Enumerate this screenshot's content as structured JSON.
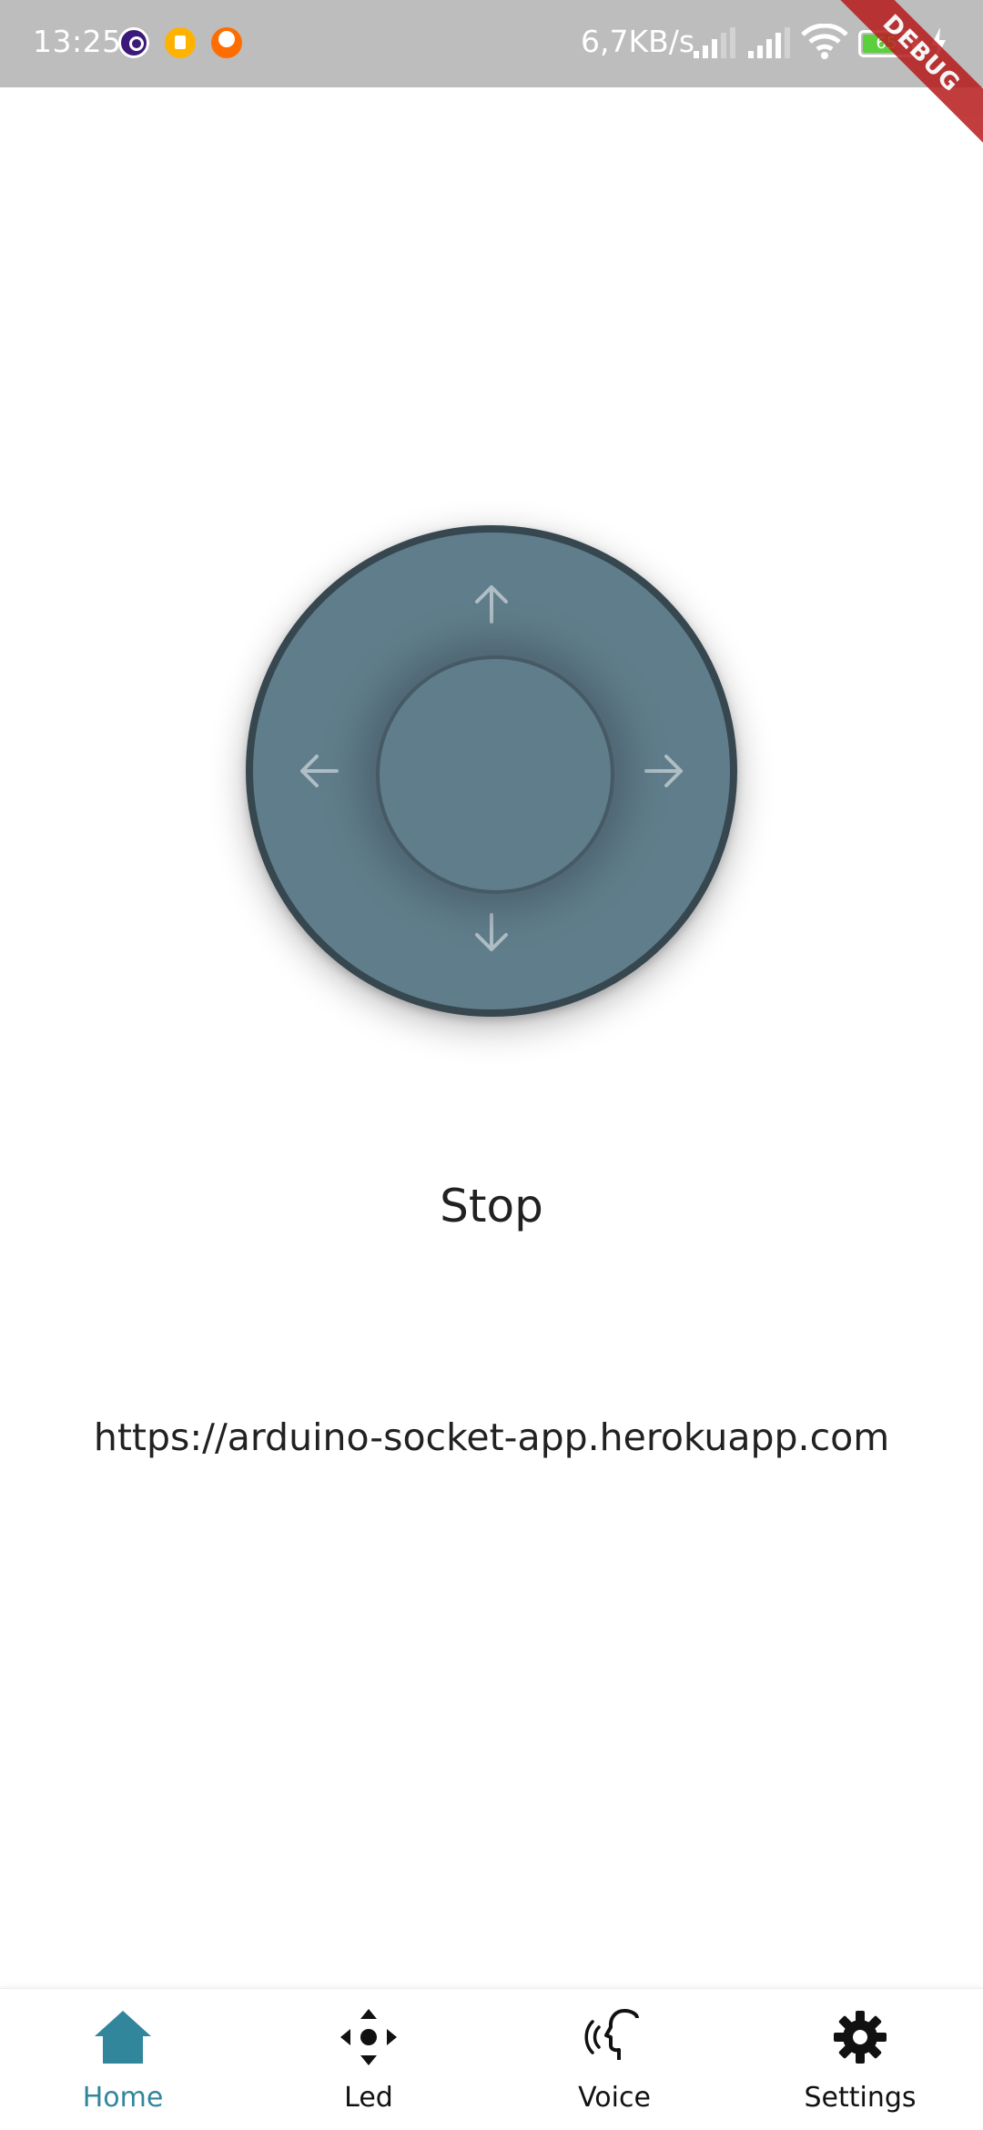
{
  "status_bar": {
    "time": "13:25",
    "net_speed": "6,7KB/s",
    "battery_level": "65",
    "background": "#bdbdbd"
  },
  "debug_banner": "DEBUG",
  "joystick": {
    "base_color": "#607d8b",
    "border_color": "#37474f",
    "arrow_color": "#b0bec5",
    "arrows": [
      "up-arrow-icon",
      "down-arrow-icon",
      "left-arrow-icon",
      "right-arrow-icon"
    ]
  },
  "main": {
    "status": "Stop",
    "server_url": "https://arduino-socket-app.herokuapp.com"
  },
  "bottom_nav": {
    "active_color": "#31869c",
    "items": [
      {
        "label": "Home",
        "icon": "home-icon",
        "active": true
      },
      {
        "label": "Led",
        "icon": "move-icon",
        "active": false
      },
      {
        "label": "Voice",
        "icon": "voice-icon",
        "active": false
      },
      {
        "label": "Settings",
        "icon": "gear-icon",
        "active": false
      }
    ]
  }
}
